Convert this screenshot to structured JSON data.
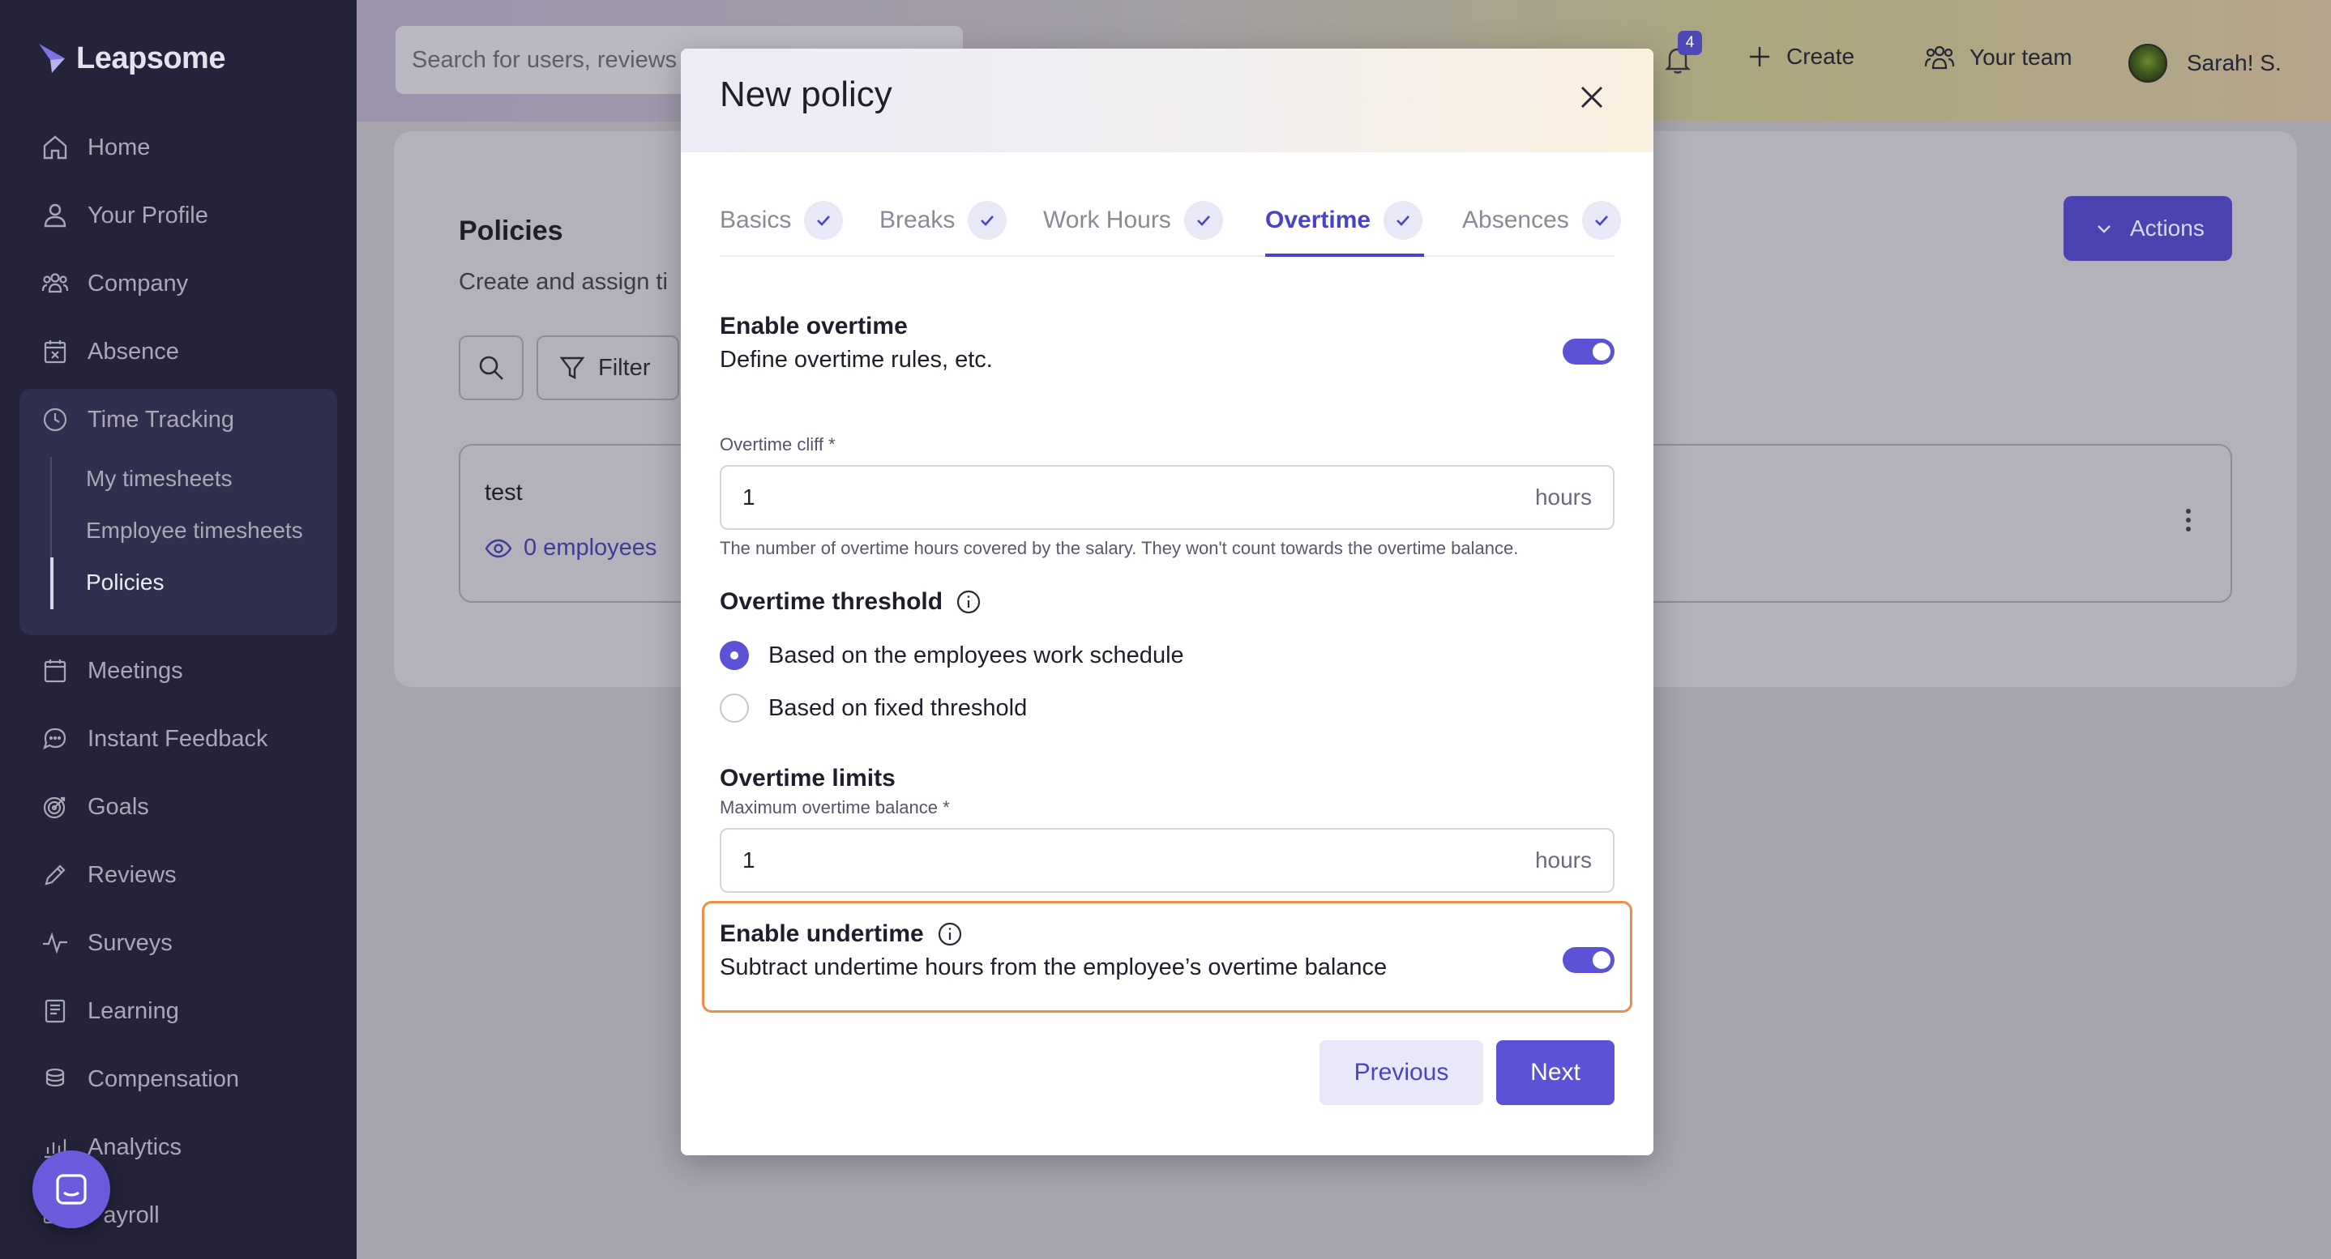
{
  "brand": {
    "name": "Leapsome",
    "accent": "#5b52d6",
    "sidebar_bg": "#24233a"
  },
  "sidebar": {
    "items": [
      {
        "label": "Home",
        "icon": "home-icon"
      },
      {
        "label": "Your Profile",
        "icon": "user-icon"
      },
      {
        "label": "Company",
        "icon": "people-icon"
      },
      {
        "label": "Absence",
        "icon": "calendar-x-icon"
      },
      {
        "label": "Time Tracking",
        "icon": "clock-icon"
      },
      {
        "label": "Meetings",
        "icon": "calendar-icon"
      },
      {
        "label": "Instant Feedback",
        "icon": "chat-icon"
      },
      {
        "label": "Goals",
        "icon": "target-icon"
      },
      {
        "label": "Reviews",
        "icon": "pencil-icon"
      },
      {
        "label": "Surveys",
        "icon": "pulse-icon"
      },
      {
        "label": "Learning",
        "icon": "book-icon"
      },
      {
        "label": "Compensation",
        "icon": "coins-icon"
      },
      {
        "label": "Analytics",
        "icon": "chart-icon"
      },
      {
        "label": "Payroll",
        "icon": "payroll-icon"
      }
    ],
    "time_tracking_sub": [
      {
        "label": "My timesheets"
      },
      {
        "label": "Employee timesheets"
      },
      {
        "label": "Policies",
        "active": true
      }
    ]
  },
  "topbar": {
    "search_placeholder": "Search for users, reviews",
    "notifications_count": "4",
    "create_label": "Create",
    "team_label": "Your team",
    "user_name": "Sarah! S."
  },
  "page": {
    "title": "Policies",
    "description": "Create and assign ti",
    "filter_label": "Filter",
    "actions_label": "Actions",
    "policy": {
      "name": "test",
      "employees": "0 employees"
    }
  },
  "modal": {
    "title": "New policy",
    "tabs": [
      {
        "label": "Basics",
        "done": true
      },
      {
        "label": "Breaks",
        "done": true
      },
      {
        "label": "Work Hours",
        "done": true
      },
      {
        "label": "Overtime",
        "done": true,
        "active": true
      },
      {
        "label": "Absences",
        "done": true
      }
    ],
    "enable_overtime": {
      "title": "Enable overtime",
      "desc": "Define overtime rules, etc.",
      "on": true
    },
    "overtime_cliff": {
      "label": "Overtime cliff *",
      "value": "1",
      "unit": "hours",
      "help": "The number of overtime hours covered by the salary. They won't count towards the overtime balance."
    },
    "threshold": {
      "title": "Overtime threshold",
      "options": [
        {
          "label": "Based on the employees work schedule",
          "selected": true
        },
        {
          "label": "Based on fixed threshold",
          "selected": false
        }
      ]
    },
    "limits": {
      "title": "Overtime limits",
      "label": "Maximum overtime balance *",
      "value": "1",
      "unit": "hours"
    },
    "undertime": {
      "title": "Enable undertime",
      "desc": "Subtract undertime hours from the employee’s overtime balance",
      "on": true
    },
    "previous_label": "Previous",
    "next_label": "Next"
  }
}
